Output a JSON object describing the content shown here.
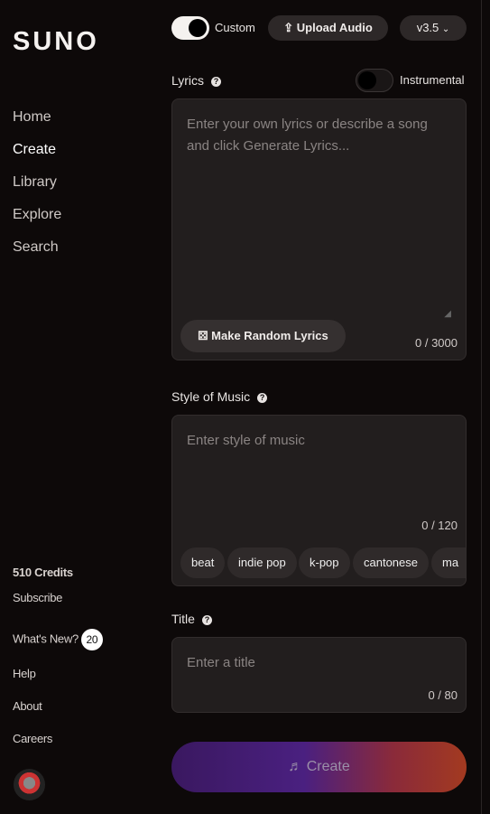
{
  "logo": "SUNO",
  "nav": [
    "Home",
    "Create",
    "Library",
    "Explore",
    "Search"
  ],
  "sidebar": {
    "credits": "510 Credits",
    "subscribe": "Subscribe",
    "whats_new": "What's New?",
    "whats_new_count": "20",
    "help": "Help",
    "about": "About",
    "careers": "Careers"
  },
  "top": {
    "custom_label": "Custom",
    "custom_on": true,
    "upload": "Upload Audio",
    "version": "v3.5"
  },
  "lyrics": {
    "label": "Lyrics",
    "instrumental": "Instrumental",
    "instrumental_on": false,
    "placeholder": "Enter your own lyrics or describe a song and click Generate Lyrics...",
    "random": "Make Random Lyrics",
    "count": "0 / 3000"
  },
  "style": {
    "label": "Style of Music",
    "placeholder": "Enter style of music",
    "count": "0 / 120",
    "tags": [
      "beat",
      "indie pop",
      "k-pop",
      "cantonese",
      "ma"
    ]
  },
  "title": {
    "label": "Title",
    "placeholder": "Enter a title",
    "count": "0 / 80"
  },
  "create": "Create"
}
